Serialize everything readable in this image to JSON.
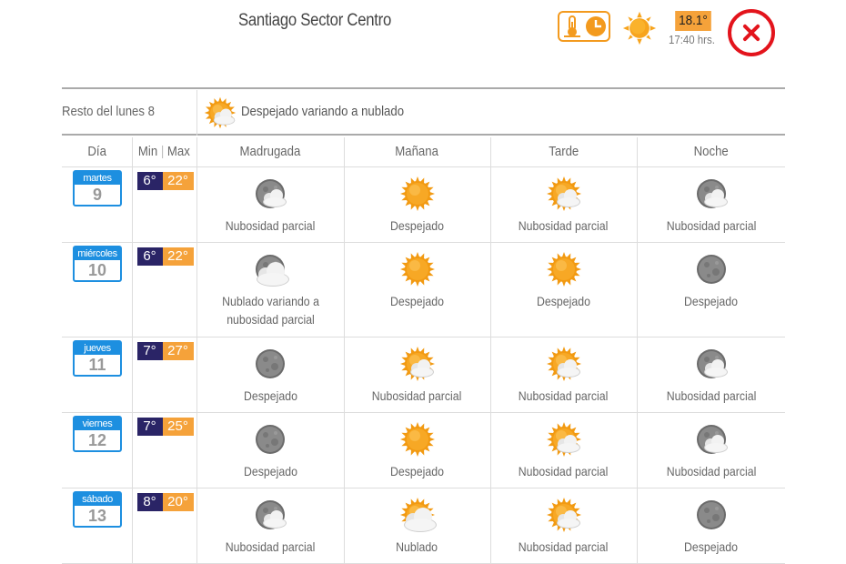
{
  "header": {
    "location": "Santiago Sector Centro",
    "current_temp": "18.1°",
    "current_time": "17:40 hrs.",
    "current_icon": "sun-icon",
    "toggle_icon": "thermometer-clock-icon",
    "close_icon": "close-icon"
  },
  "rest_of_day": {
    "label": "Resto del lunes 8",
    "icon": "sun-cloud-icon",
    "description": "Despejado variando a nublado"
  },
  "table": {
    "headers": {
      "day": "Día",
      "min": "Min",
      "sep": "|",
      "max": "Max",
      "madrugada": "Madrugada",
      "manana": "Mañana",
      "tarde": "Tarde",
      "noche": "Noche"
    },
    "rows": [
      {
        "weekday": "martes",
        "date": "9",
        "min": "6°",
        "max": "22°",
        "madrugada": {
          "icon": "moon-cloud",
          "desc": "Nubosidad parcial"
        },
        "manana": {
          "icon": "sun",
          "desc": "Despejado"
        },
        "tarde": {
          "icon": "sun-cloud",
          "desc": "Nubosidad parcial"
        },
        "noche": {
          "icon": "moon-cloud",
          "desc": "Nubosidad parcial"
        }
      },
      {
        "weekday": "miércoles",
        "date": "10",
        "min": "6°",
        "max": "22°",
        "madrugada": {
          "icon": "moon-bigcloud",
          "desc": "Nublado variando a nubosidad parcial"
        },
        "manana": {
          "icon": "sun",
          "desc": "Despejado"
        },
        "tarde": {
          "icon": "sun",
          "desc": "Despejado"
        },
        "noche": {
          "icon": "moon",
          "desc": "Despejado"
        }
      },
      {
        "weekday": "jueves",
        "date": "11",
        "min": "7°",
        "max": "27°",
        "madrugada": {
          "icon": "moon",
          "desc": "Despejado"
        },
        "manana": {
          "icon": "sun-cloud",
          "desc": "Nubosidad parcial"
        },
        "tarde": {
          "icon": "sun-cloud",
          "desc": "Nubosidad parcial"
        },
        "noche": {
          "icon": "moon-cloud",
          "desc": "Nubosidad parcial"
        }
      },
      {
        "weekday": "viernes",
        "date": "12",
        "min": "7°",
        "max": "25°",
        "madrugada": {
          "icon": "moon",
          "desc": "Despejado"
        },
        "manana": {
          "icon": "sun",
          "desc": "Despejado"
        },
        "tarde": {
          "icon": "sun-cloud",
          "desc": "Nubosidad parcial"
        },
        "noche": {
          "icon": "moon-cloud",
          "desc": "Nubosidad parcial"
        }
      },
      {
        "weekday": "sábado",
        "date": "13",
        "min": "8°",
        "max": "20°",
        "madrugada": {
          "icon": "moon-cloud",
          "desc": "Nubosidad parcial"
        },
        "manana": {
          "icon": "sun-bigcloud",
          "desc": "Nublado"
        },
        "tarde": {
          "icon": "sun-cloud",
          "desc": "Nubosidad parcial"
        },
        "noche": {
          "icon": "moon",
          "desc": "Despejado"
        }
      }
    ]
  },
  "colors": {
    "accent_orange": "#f5a23a",
    "min_badge": "#2a2466",
    "calendar_blue": "#1d8fe0",
    "close_red": "#e3141c"
  }
}
